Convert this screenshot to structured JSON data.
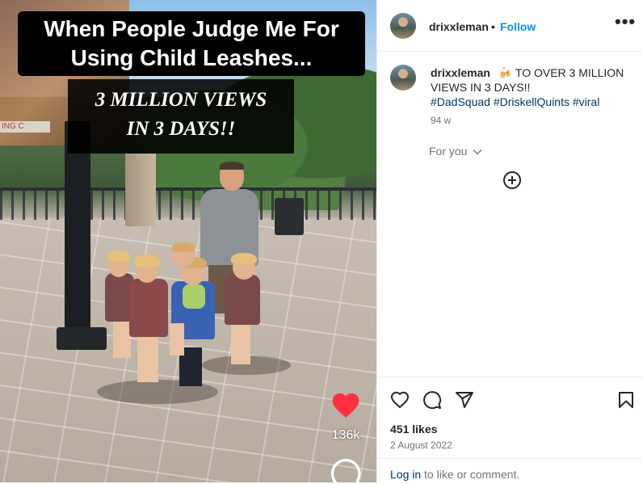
{
  "media": {
    "caption_top": "When People Judge Me For\nUsing Child Leashes...",
    "caption_sub": "3 MILLION VIEWS\nIN 3 DAYS!!",
    "sign_text": "ING C",
    "like_count": "136k",
    "heart_icon": "heart-filled-icon",
    "heart_color": "#ff3040",
    "comment_icon": "comment-bubble-icon"
  },
  "header": {
    "username": "drixxleman",
    "separator": "•",
    "follow_label": "Follow",
    "more_icon": "more-horizontal-icon",
    "more_label": "•••"
  },
  "caption": {
    "username": "drixxleman",
    "emoji": "🍻",
    "text": "TO OVER 3 MILLION VIEWS IN 3 DAYS!!",
    "hashtags": [
      "#DadSquad",
      "#DriskellQuints",
      "#viral"
    ],
    "age": "94 w"
  },
  "for_you": {
    "label": "For you",
    "chevron_icon": "chevron-down-icon"
  },
  "add_icon": "plus-circle-icon",
  "actions": {
    "icons": [
      "heart-outline-icon",
      "comment-icon",
      "share-icon",
      "bookmark-icon"
    ],
    "likes": "451 likes",
    "date": "2 August 2022"
  },
  "login": {
    "link_text": "Log in",
    "rest_text": "to like or comment."
  },
  "colors": {
    "link_blue": "#0095f6",
    "hashtag_blue": "#00376b",
    "muted": "#737373",
    "like_red": "#ff3040"
  }
}
